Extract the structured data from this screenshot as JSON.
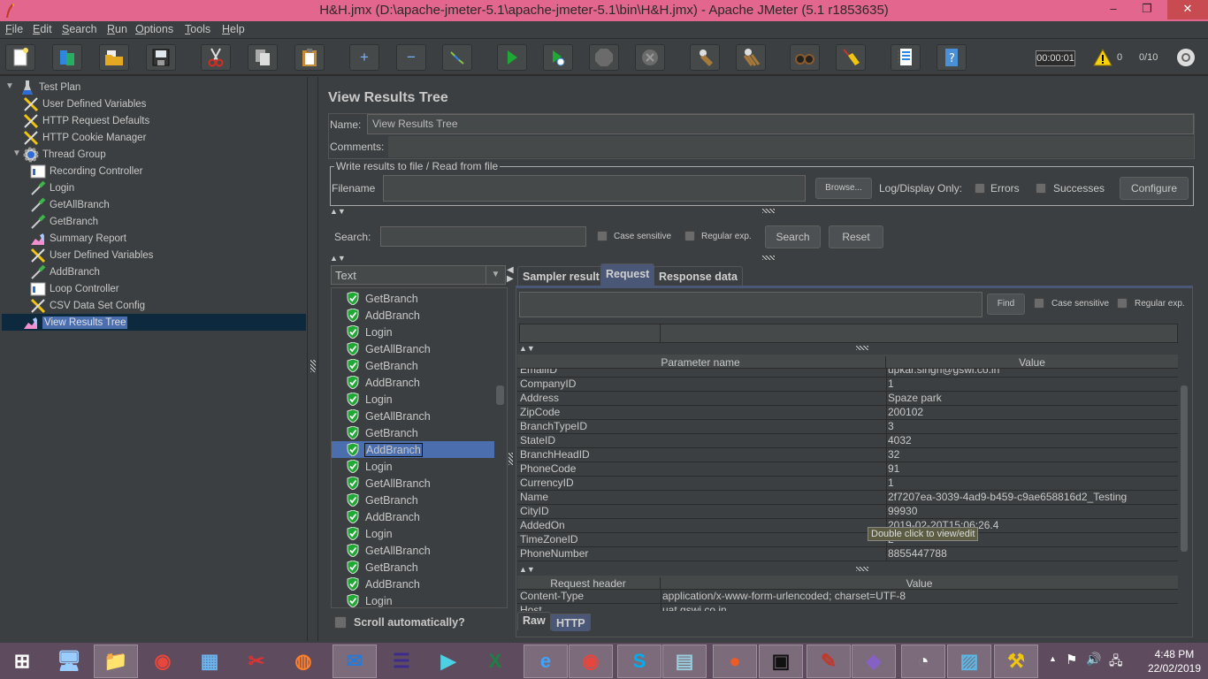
{
  "window": {
    "title": "H&H.jmx (D:\\apache-jmeter-5.1\\apache-jmeter-5.1\\bin\\H&H.jmx) - Apache JMeter (5.1 r1853635)",
    "minimize": "–",
    "maximize": "❐",
    "close": "✕"
  },
  "menu": [
    {
      "label": "File",
      "mnemonic": "F"
    },
    {
      "label": "Edit",
      "mnemonic": "E"
    },
    {
      "label": "Search",
      "mnemonic": "S"
    },
    {
      "label": "Run",
      "mnemonic": "R"
    },
    {
      "label": "Options",
      "mnemonic": "O"
    },
    {
      "label": "Tools",
      "mnemonic": "T"
    },
    {
      "label": "Help",
      "mnemonic": "H"
    }
  ],
  "toolbar": {
    "buttons": [
      {
        "name": "new",
        "icon": "new-file-icon"
      },
      {
        "name": "templates",
        "icon": "templates-icon"
      },
      {
        "name": "open",
        "icon": "open-folder-icon"
      },
      {
        "name": "save",
        "icon": "save-icon"
      },
      {
        "name": "cut",
        "icon": "cut-icon"
      },
      {
        "name": "copy",
        "icon": "copy-icon"
      },
      {
        "name": "paste",
        "icon": "paste-icon"
      },
      {
        "name": "expand",
        "icon": "expand-icon",
        "glyph": "+"
      },
      {
        "name": "collapse",
        "icon": "collapse-icon",
        "glyph": "−"
      },
      {
        "name": "toggle",
        "icon": "toggle-icon"
      },
      {
        "name": "start",
        "icon": "start-icon"
      },
      {
        "name": "start-no-pauses",
        "icon": "start-no-pauses-icon"
      },
      {
        "name": "stop",
        "icon": "stop-icon"
      },
      {
        "name": "shutdown",
        "icon": "shutdown-icon"
      },
      {
        "name": "clear",
        "icon": "clear-icon"
      },
      {
        "name": "clear-all",
        "icon": "clear-all-icon"
      },
      {
        "name": "search",
        "icon": "binoculars-icon"
      },
      {
        "name": "reset-search",
        "icon": "broom-icon"
      },
      {
        "name": "function-helper",
        "icon": "function-helper-icon"
      },
      {
        "name": "help",
        "icon": "help-icon"
      }
    ],
    "timer": "00:00:01",
    "warnings": "0",
    "threads": "0/10"
  },
  "tree": {
    "items": [
      {
        "label": "Test Plan",
        "icon": "test-plan-icon",
        "level": 0,
        "expanded": true
      },
      {
        "label": "User Defined Variables",
        "icon": "config-wrench-icon",
        "level": 1
      },
      {
        "label": "HTTP Request Defaults",
        "icon": "config-wrench-icon",
        "level": 1
      },
      {
        "label": "HTTP Cookie Manager",
        "icon": "config-wrench-icon",
        "level": 1
      },
      {
        "label": "Thread Group",
        "icon": "thread-group-gear-icon",
        "level": 1,
        "expanded": true
      },
      {
        "label": "Recording Controller",
        "icon": "controller-icon",
        "level": 2
      },
      {
        "label": "Login",
        "icon": "sampler-pipette-icon",
        "level": 2
      },
      {
        "label": "GetAllBranch",
        "icon": "sampler-pipette-icon",
        "level": 2
      },
      {
        "label": "GetBranch",
        "icon": "sampler-pipette-icon",
        "level": 2
      },
      {
        "label": "Summary Report",
        "icon": "listener-chart-icon",
        "level": 2
      },
      {
        "label": "User Defined Variables",
        "icon": "config-wrench-icon",
        "level": 2
      },
      {
        "label": "AddBranch",
        "icon": "sampler-pipette-icon",
        "level": 2
      },
      {
        "label": "Loop Controller",
        "icon": "controller-icon",
        "level": 2
      },
      {
        "label": "CSV Data Set Config",
        "icon": "config-wrench-icon",
        "level": 2
      },
      {
        "label": "View Results Tree",
        "icon": "listener-chart-icon",
        "level": 1,
        "selected": true
      }
    ]
  },
  "panel": {
    "title": "View Results Tree",
    "name_label": "Name:",
    "name_value": "View Results Tree",
    "comments_label": "Comments:",
    "comments_value": "",
    "file_group_label": "Write results to file / Read from file",
    "filename_label": "Filename",
    "filename_value": "",
    "browse_label": "Browse...",
    "log_display_label": "Log/Display Only:",
    "errors_label": "Errors",
    "successes_label": "Successes",
    "configure_label": "Configure",
    "search_label": "Search:",
    "search_value": "",
    "case_sensitive_label": "Case sensitive",
    "regex_label": "Regular exp.",
    "search_button": "Search",
    "reset_button": "Reset"
  },
  "results": {
    "renderer": "Text",
    "scroll_auto_label": "Scroll automatically?",
    "items": [
      {
        "label": "GetBranch",
        "status": "success"
      },
      {
        "label": "AddBranch",
        "status": "success"
      },
      {
        "label": "Login",
        "status": "success"
      },
      {
        "label": "GetAllBranch",
        "status": "success"
      },
      {
        "label": "GetBranch",
        "status": "success"
      },
      {
        "label": "AddBranch",
        "status": "success"
      },
      {
        "label": "Login",
        "status": "success"
      },
      {
        "label": "GetAllBranch",
        "status": "success"
      },
      {
        "label": "GetBranch",
        "status": "success"
      },
      {
        "label": "AddBranch",
        "status": "success",
        "selected": true
      },
      {
        "label": "Login",
        "status": "success"
      },
      {
        "label": "GetAllBranch",
        "status": "success"
      },
      {
        "label": "GetBranch",
        "status": "success"
      },
      {
        "label": "AddBranch",
        "status": "success"
      },
      {
        "label": "Login",
        "status": "success"
      },
      {
        "label": "GetAllBranch",
        "status": "success"
      },
      {
        "label": "GetBranch",
        "status": "success"
      },
      {
        "label": "AddBranch",
        "status": "success"
      },
      {
        "label": "Login",
        "status": "success"
      }
    ]
  },
  "detail": {
    "tabs": [
      {
        "label": "Sampler result",
        "active": false
      },
      {
        "label": "Request",
        "active": true
      },
      {
        "label": "Response data",
        "active": false
      }
    ],
    "find_value": "",
    "find_button": "Find",
    "case_sensitive_label": "Case sensitive",
    "regex_label": "Regular exp.",
    "params_headers": [
      "Parameter name",
      "Value"
    ],
    "params": [
      {
        "name": "EmailID",
        "value": "upkar.singh@gswi.co.in"
      },
      {
        "name": "CompanyID",
        "value": "1"
      },
      {
        "name": "Address",
        "value": "Spaze park"
      },
      {
        "name": "ZipCode",
        "value": "200102"
      },
      {
        "name": "BranchTypeID",
        "value": "3"
      },
      {
        "name": "StateID",
        "value": "4032"
      },
      {
        "name": "BranchHeadID",
        "value": "32"
      },
      {
        "name": "PhoneCode",
        "value": "91"
      },
      {
        "name": "CurrencyID",
        "value": "1"
      },
      {
        "name": "Name",
        "value": "2f7207ea-3039-4ad9-b459-c9ae658816d2_Testing"
      },
      {
        "name": "CityID",
        "value": "99930"
      },
      {
        "name": "AddedOn",
        "value": "2019-02-20T15:06:26.4"
      },
      {
        "name": "TimeZoneID",
        "value": "2"
      },
      {
        "name": "PhoneNumber",
        "value": "8855447788"
      }
    ],
    "tooltip": "Double click to view/edit",
    "headers_headers": [
      "Request header",
      "Value"
    ],
    "headers": [
      {
        "name": "Content-Type",
        "value": "application/x-www-form-urlencoded; charset=UTF-8"
      },
      {
        "name": "Host",
        "value": "uat.gswi.co.in"
      }
    ],
    "bottom_tabs": [
      {
        "label": "Raw",
        "active": false
      },
      {
        "label": "HTTP",
        "active": true
      }
    ]
  },
  "taskbar": {
    "apps": [
      {
        "name": "start",
        "icon": "windows-start-icon"
      },
      {
        "name": "this-pc",
        "icon": "computer-icon"
      },
      {
        "name": "file-explorer",
        "icon": "folder-icon",
        "active": true
      },
      {
        "name": "chrome",
        "icon": "chrome-icon"
      },
      {
        "name": "calculator",
        "icon": "calculator-icon"
      },
      {
        "name": "snipping-tool",
        "icon": "scissors-icon"
      },
      {
        "name": "firefox",
        "icon": "firefox-icon"
      },
      {
        "name": "outlook",
        "icon": "outlook-icon",
        "active": true
      },
      {
        "name": "eclipse",
        "icon": "eclipse-icon"
      },
      {
        "name": "camera",
        "icon": "video-icon"
      },
      {
        "name": "excel",
        "icon": "excel-icon"
      },
      {
        "name": "internet-explorer",
        "icon": "ie-icon",
        "active": true
      },
      {
        "name": "chrome-2",
        "icon": "chrome-icon",
        "active": true
      },
      {
        "name": "skype",
        "icon": "skype-icon",
        "active": true
      },
      {
        "name": "notepad",
        "icon": "notepad-icon",
        "active": true
      },
      {
        "name": "postman",
        "icon": "postman-icon",
        "active": true
      },
      {
        "name": "cmd",
        "icon": "terminal-icon",
        "active": true
      },
      {
        "name": "jmeter",
        "icon": "jmeter-feather-icon",
        "active": true
      },
      {
        "name": "visual-studio",
        "icon": "visual-studio-icon",
        "active": true
      },
      {
        "name": "app-c",
        "icon": "clock-app-icon",
        "active": true
      },
      {
        "name": "photos",
        "icon": "photo-icon",
        "active": true
      },
      {
        "name": "db-tool",
        "icon": "db-tools-icon",
        "active": true
      }
    ],
    "time": "4:48 PM",
    "date": "22/02/2019"
  }
}
